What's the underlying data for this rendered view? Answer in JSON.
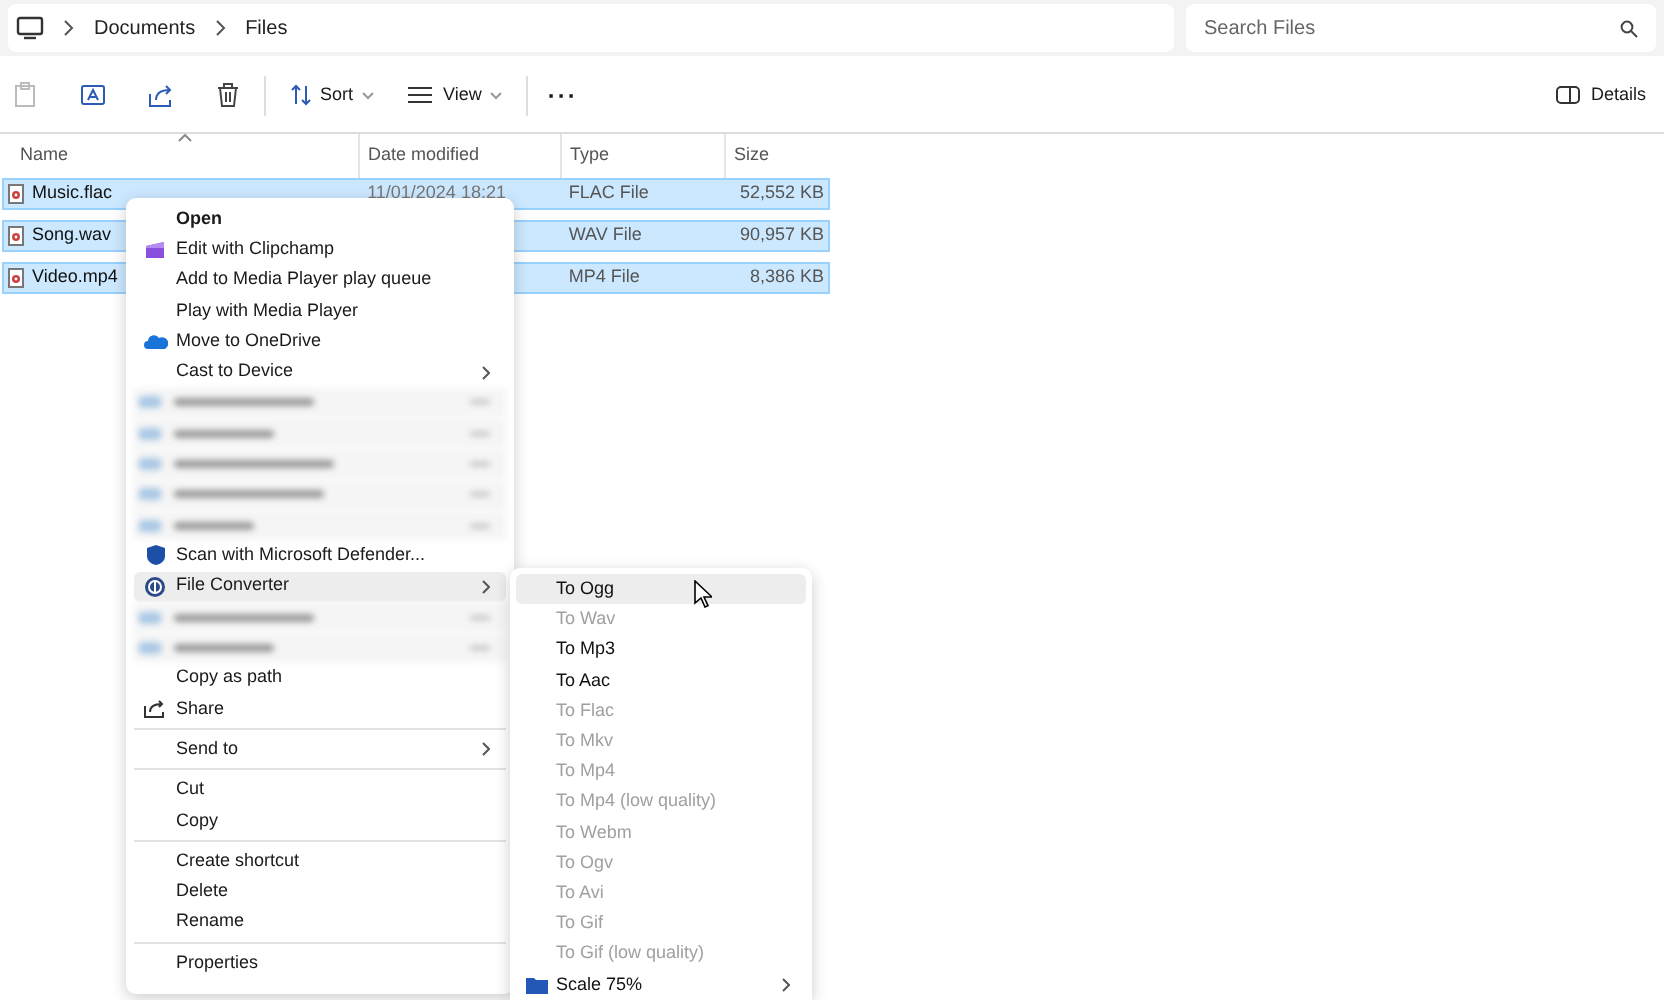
{
  "breadcrumb": [
    "Documents",
    "Files"
  ],
  "search": {
    "placeholder": "Search Files"
  },
  "toolbar": {
    "sort": "Sort",
    "view": "View",
    "more": "···",
    "details": "Details"
  },
  "columns": [
    "Name",
    "Date modified",
    "Type",
    "Size"
  ],
  "rows": [
    {
      "name": "Music.flac",
      "date": "11/01/2024 18:21",
      "type": "FLAC File",
      "size": "52,552 KB",
      "selected": true
    },
    {
      "name": "Song.wav",
      "type": "WAV File",
      "size": "90,957 KB",
      "selected": true
    },
    {
      "name": "Video.mp4",
      "type": "MP4 File",
      "size": "8,386 KB",
      "selected": true
    }
  ],
  "context_menu": [
    {
      "kind": "item",
      "label": "Open",
      "bold": true
    },
    {
      "kind": "item",
      "label": "Edit with Clipchamp"
    },
    {
      "kind": "item",
      "label": "Add to Media Player play queue"
    },
    {
      "kind": "item",
      "label": "Play with Media Player"
    },
    {
      "kind": "item",
      "label": "Move to OneDrive"
    },
    {
      "kind": "item",
      "label": "Cast to Device",
      "submenu": true
    },
    {
      "kind": "blurred"
    },
    {
      "kind": "blurred"
    },
    {
      "kind": "blurred"
    },
    {
      "kind": "blurred"
    },
    {
      "kind": "blurred"
    },
    {
      "kind": "item",
      "label": "Scan with Microsoft Defender..."
    },
    {
      "kind": "item",
      "label": "File Converter",
      "submenu": true,
      "highlighted": true
    },
    {
      "kind": "blurred"
    },
    {
      "kind": "blurred"
    },
    {
      "kind": "item",
      "label": "Copy as path"
    },
    {
      "kind": "item",
      "label": "Share"
    },
    {
      "kind": "separator"
    },
    {
      "kind": "item",
      "label": "Send to",
      "submenu": true
    },
    {
      "kind": "separator"
    },
    {
      "kind": "item",
      "label": "Cut"
    },
    {
      "kind": "item",
      "label": "Copy"
    },
    {
      "kind": "separator"
    },
    {
      "kind": "item",
      "label": "Create shortcut"
    },
    {
      "kind": "item",
      "label": "Delete"
    },
    {
      "kind": "item",
      "label": "Rename"
    },
    {
      "kind": "separator"
    },
    {
      "kind": "item",
      "label": "Properties"
    }
  ],
  "submenu": [
    {
      "label": "To Ogg",
      "disabled": false,
      "highlighted": true
    },
    {
      "label": "To Wav",
      "disabled": true
    },
    {
      "label": "To Mp3",
      "disabled": false
    },
    {
      "label": "To Aac",
      "disabled": false
    },
    {
      "label": "To Flac",
      "disabled": true
    },
    {
      "label": "To Mkv",
      "disabled": true
    },
    {
      "label": "To Mp4",
      "disabled": true
    },
    {
      "label": "To Mp4 (low quality)",
      "disabled": true
    },
    {
      "label": "To Webm",
      "disabled": true
    },
    {
      "label": "To Ogv",
      "disabled": true
    },
    {
      "label": "To Avi",
      "disabled": true
    },
    {
      "label": "To Gif",
      "disabled": true
    },
    {
      "label": "To Gif (low quality)",
      "disabled": true
    },
    {
      "label": "Scale 75%",
      "disabled": false,
      "submenu": true
    }
  ]
}
